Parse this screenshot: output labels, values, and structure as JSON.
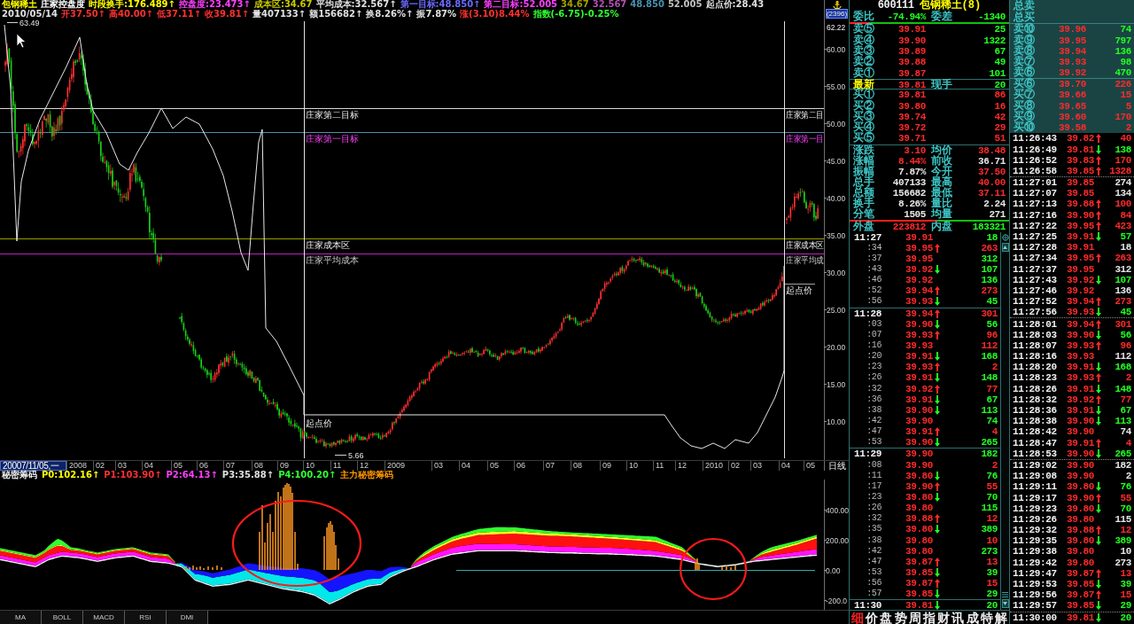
{
  "quote_header": {
    "line_1": [
      {
        "text": "包钢稀土",
        "color": "#ffff00"
      },
      {
        "text": "庄家控盘度",
        "color": "#ffffff"
      },
      {
        "text": "时段换手:176.489↑",
        "color": "#ffff00"
      },
      {
        "text": "控盘度:23.473↑",
        "color": "#ff40ff"
      },
      {
        "text": "成本区:34.67",
        "color": "#c8c800"
      },
      {
        "text": "平均成本:32.567↑",
        "color": "#e0e0e0"
      },
      {
        "text": "第一目标:48.850↑",
        "color": "#6a6aff"
      },
      {
        "text": "第二目标:52.005",
        "color": "#ff40ff"
      },
      {
        "text": "34.67",
        "color": "#a0a000"
      },
      {
        "text": "32.567",
        "color": "#b050b0"
      },
      {
        "text": "48.850",
        "color": "#4a90b0"
      },
      {
        "text": "52.005",
        "color": "#c0c0c0"
      },
      {
        "text": "起点价:28.43",
        "color": "#e0e0e0"
      }
    ],
    "line_2": [
      {
        "text": "2010/05/14",
        "color": "#e0e0e0"
      },
      {
        "text": "开37.50↑",
        "color": "#ff3030"
      },
      {
        "text": "高40.00↑",
        "color": "#ff3030"
      },
      {
        "text": "低37.11↑",
        "color": "#ff3030"
      },
      {
        "text": "收39.81↑",
        "color": "#ff3030"
      },
      {
        "text": "量407133↑",
        "color": "#e0e0e0"
      },
      {
        "text": "额156682↑",
        "color": "#e0e0e0"
      },
      {
        "text": "换8.26%↑",
        "color": "#e0e0e0"
      },
      {
        "text": "振7.87%",
        "color": "#e0e0e0"
      },
      {
        "text": "涨(3.10)8.44%",
        "color": "#ff3030"
      },
      {
        "text": "指数(-6.75)-0.25%",
        "color": "#30ff30"
      }
    ],
    "code_badge": "(2396)"
  },
  "price_chart": {
    "high_label": "63.49",
    "axis_top_label": "62.22",
    "low_label": "5.66",
    "y_ticks": [
      "60.00",
      "55.00",
      "50.00",
      "45.00",
      "40.00",
      "35.00",
      "30.00",
      "25.00",
      "20.00",
      "15.00",
      "10.00"
    ],
    "levels": [
      {
        "kind": "second_target",
        "label": "庄家第二目标",
        "edge_label": "庄家第二目"
      },
      {
        "kind": "first_target",
        "label": "庄家第一目标",
        "edge_label": "庄家第一目"
      },
      {
        "kind": "cost_zone",
        "label": "庄家成本区",
        "edge_label": "庄家成本区"
      },
      {
        "kind": "average_cost",
        "label": "庄家平均成本",
        "edge_label": "庄家平均成"
      },
      {
        "kind": "start_price",
        "label": "起点价",
        "edge_label": "起点价"
      }
    ]
  },
  "x_axis": {
    "cursor_date": "20007/11/05,一",
    "labels": [
      "2008",
      "02",
      "03",
      "04",
      "05",
      "06",
      "07",
      "08",
      "09",
      "10",
      "11",
      "12",
      "2009",
      "03",
      "04",
      "05",
      "06",
      "07",
      "08",
      "09",
      "10",
      "11",
      "12",
      "2010",
      "02",
      "03",
      "04",
      "05"
    ],
    "period": "日线"
  },
  "indicator": {
    "title": "秘密筹码",
    "values": [
      {
        "text": "P0:102.16↑",
        "color": "#ffff00"
      },
      {
        "text": "P1:103.90↑",
        "color": "#ff3030"
      },
      {
        "text": "P2:64.13↑",
        "color": "#ff40ff"
      },
      {
        "text": "P3:35.88↑",
        "color": "#e0e0e0"
      },
      {
        "text": "P4:100.20↑",
        "color": "#30ff30"
      },
      {
        "text": "主力秘密筹码",
        "color": "#ff9900"
      }
    ],
    "y_ticks": [
      "400.00",
      "200.00",
      "0.00",
      "-200.0"
    ],
    "tabs": [
      "MA",
      "BOLL",
      "MACD",
      "RSI",
      "DMI"
    ]
  },
  "quote_panel": {
    "code": "600111",
    "name": "包钢稀土(8)",
    "ratio": {
      "label": "委比",
      "value": "-74.94%",
      "diff_label": "委差",
      "diff": "-1340",
      "level": 0.13
    },
    "asks": [
      {
        "label": "卖⑤",
        "price": "39.91",
        "volume": "25"
      },
      {
        "label": "卖④",
        "price": "39.90",
        "volume": "1322"
      },
      {
        "label": "卖③",
        "price": "39.89",
        "volume": "67"
      },
      {
        "label": "卖②",
        "price": "39.88",
        "volume": "49"
      },
      {
        "label": "卖①",
        "price": "39.87",
        "volume": "101"
      }
    ],
    "last": {
      "label": "最新",
      "price": "39.81",
      "hand_label": "现手",
      "hand": "20"
    },
    "bids": [
      {
        "label": "买①",
        "price": "39.81",
        "volume": "86"
      },
      {
        "label": "买②",
        "price": "39.80",
        "volume": "16"
      },
      {
        "label": "买③",
        "price": "39.74",
        "volume": "42"
      },
      {
        "label": "买④",
        "price": "39.72",
        "volume": "29"
      },
      {
        "label": "买⑤",
        "price": "39.71",
        "volume": "51"
      }
    ],
    "stats": [
      {
        "cells": [
          {
            "label": "涨跌",
            "value": "3.10",
            "kind": "up"
          },
          {
            "label": "均价",
            "value": "38.48",
            "kind": "up"
          }
        ]
      },
      {
        "cells": [
          {
            "label": "涨幅",
            "value": "8.44%",
            "kind": "up"
          },
          {
            "label": "前收",
            "value": "36.71",
            "kind": "flat"
          }
        ]
      },
      {
        "cells": [
          {
            "label": "振幅",
            "value": "7.87%",
            "kind": "flat"
          },
          {
            "label": "今开",
            "value": "37.50",
            "kind": "up"
          }
        ]
      },
      {
        "cells": [
          {
            "label": "总手",
            "value": "407133",
            "kind": "flat"
          },
          {
            "label": "最高",
            "value": "40.00",
            "kind": "up"
          }
        ]
      },
      {
        "cells": [
          {
            "label": "总额",
            "value": "156682",
            "kind": "flat"
          },
          {
            "label": "最低",
            "value": "37.11",
            "kind": "up"
          }
        ]
      },
      {
        "cells": [
          {
            "label": "换手",
            "value": "8.26%",
            "kind": "flat"
          },
          {
            "label": "量比",
            "value": "2.24",
            "kind": "flat"
          }
        ]
      },
      {
        "cells": [
          {
            "label": "分笔",
            "value": "1505",
            "kind": "flat"
          },
          {
            "label": "均量",
            "value": "271",
            "kind": "flat"
          }
        ]
      },
      {
        "cells": [
          {
            "label": "外盘",
            "value": "223812",
            "kind": "up"
          },
          {
            "label": "内盘",
            "value": "183321",
            "kind": "down"
          }
        ]
      }
    ],
    "volume_split": {
      "level": 0.55
    },
    "ticks_by_minute": [
      {
        "rows": [
          {
            "time": "11:27",
            "price": "39.91",
            "kind": "flat",
            "buy": false,
            "volume": "18"
          },
          {
            "time": ":34",
            "price": "39.95",
            "kind": "up",
            "buy": true,
            "volume": "263"
          },
          {
            "time": ":37",
            "price": "39.95",
            "kind": "flat",
            "buy": false,
            "volume": "312"
          },
          {
            "time": ":43",
            "price": "39.92",
            "kind": "down",
            "buy": false,
            "volume": "107"
          },
          {
            "time": ":46",
            "price": "39.92",
            "kind": "flat",
            "buy": false,
            "volume": "136"
          },
          {
            "time": ":52",
            "price": "39.94",
            "kind": "up",
            "buy": true,
            "volume": "273"
          },
          {
            "time": ":56",
            "price": "39.93",
            "kind": "down",
            "buy": false,
            "volume": "45"
          }
        ]
      },
      {
        "rows": [
          {
            "time": "11:28",
            "price": "39.94",
            "kind": "up",
            "buy": true,
            "volume": "301"
          },
          {
            "time": ":03",
            "price": "39.90",
            "kind": "down",
            "buy": false,
            "volume": "56"
          },
          {
            "time": ":07",
            "price": "39.93",
            "kind": "up",
            "buy": true,
            "volume": "96"
          },
          {
            "time": ":16",
            "price": "39.93",
            "kind": "flat",
            "buy": true,
            "volume": "112"
          },
          {
            "time": ":20",
            "price": "39.91",
            "kind": "down",
            "buy": false,
            "volume": "168"
          },
          {
            "time": ":23",
            "price": "39.93",
            "kind": "up",
            "buy": true,
            "volume": "2"
          },
          {
            "time": ":26",
            "price": "39.91",
            "kind": "down",
            "buy": false,
            "volume": "148"
          },
          {
            "time": ":32",
            "price": "39.92",
            "kind": "up",
            "buy": true,
            "volume": "77"
          },
          {
            "time": ":36",
            "price": "39.91",
            "kind": "down",
            "buy": false,
            "volume": "67"
          },
          {
            "time": ":38",
            "price": "39.90",
            "kind": "down",
            "buy": false,
            "volume": "113"
          },
          {
            "time": ":42",
            "price": "39.90",
            "kind": "flat",
            "buy": false,
            "volume": "74"
          },
          {
            "time": ":47",
            "price": "39.91",
            "kind": "up",
            "buy": true,
            "volume": "4"
          },
          {
            "time": ":53",
            "price": "39.90",
            "kind": "down",
            "buy": false,
            "volume": "265"
          }
        ]
      },
      {
        "rows": [
          {
            "time": "11:29",
            "price": "39.90",
            "kind": "flat",
            "buy": false,
            "volume": "182"
          },
          {
            "time": ":08",
            "price": "39.90",
            "kind": "flat",
            "buy": true,
            "volume": "2"
          },
          {
            "time": ":11",
            "price": "39.80",
            "kind": "down",
            "buy": false,
            "volume": "76"
          },
          {
            "time": ":17",
            "price": "39.90",
            "kind": "up",
            "buy": true,
            "volume": "55"
          },
          {
            "time": ":23",
            "price": "39.80",
            "kind": "down",
            "buy": false,
            "volume": "70"
          },
          {
            "time": ":26",
            "price": "39.80",
            "kind": "flat",
            "buy": false,
            "volume": "115"
          },
          {
            "time": ":32",
            "price": "39.88",
            "kind": "up",
            "buy": true,
            "volume": "12"
          },
          {
            "time": ":35",
            "price": "39.80",
            "kind": "down",
            "buy": false,
            "volume": "389"
          },
          {
            "time": ":38",
            "price": "39.80",
            "kind": "flat",
            "buy": true,
            "volume": "10"
          },
          {
            "time": ":42",
            "price": "39.80",
            "kind": "flat",
            "buy": false,
            "volume": "273"
          },
          {
            "time": ":47",
            "price": "39.87",
            "kind": "up",
            "buy": true,
            "volume": "13"
          },
          {
            "time": ":53",
            "price": "39.85",
            "kind": "down",
            "buy": false,
            "volume": "39"
          },
          {
            "time": ":56",
            "price": "39.87",
            "kind": "up",
            "buy": true,
            "volume": "15"
          },
          {
            "time": ":57",
            "price": "39.85",
            "kind": "down",
            "buy": false,
            "volume": "29"
          }
        ]
      },
      {
        "rows": [
          {
            "time": "11:30",
            "price": "39.81",
            "kind": "down",
            "buy": false,
            "volume": "20"
          }
        ]
      }
    ],
    "detail_tabs": [
      {
        "label": "细",
        "selected": true
      },
      {
        "label": "价",
        "selected": false
      },
      {
        "label": "盘",
        "selected": false
      },
      {
        "label": "势",
        "selected": false
      },
      {
        "label": "周",
        "selected": false
      },
      {
        "label": "指",
        "selected": false
      },
      {
        "label": "财",
        "selected": false
      },
      {
        "label": "讯",
        "selected": false
      },
      {
        "label": "成",
        "selected": false
      },
      {
        "label": "特",
        "selected": false
      },
      {
        "label": "解",
        "selected": false
      }
    ],
    "depth": {
      "total_ask_label": "总卖",
      "total_bid_label": "总买",
      "asks": [
        {
          "label": "卖⑩",
          "price": "39.96",
          "volume": "74"
        },
        {
          "label": "卖⑨",
          "price": "39.95",
          "volume": "797"
        },
        {
          "label": "卖⑧",
          "price": "39.94",
          "volume": "136"
        },
        {
          "label": "卖⑦",
          "price": "39.93",
          "volume": "98"
        },
        {
          "label": "卖⑥",
          "price": "39.92",
          "volume": "470"
        }
      ],
      "bids": [
        {
          "label": "买⑥",
          "price": "39.70",
          "volume": "226"
        },
        {
          "label": "买⑦",
          "price": "39.66",
          "volume": "15"
        },
        {
          "label": "买⑧",
          "price": "39.65",
          "volume": "5"
        },
        {
          "label": "买⑨",
          "price": "39.60",
          "volume": "170"
        },
        {
          "label": "买⑩",
          "price": "39.58",
          "volume": "2"
        }
      ]
    },
    "ticks_full": [
      {
        "rows": [
          {
            "time": "11:26:43",
            "price": "39.82",
            "kind": "up",
            "volume": "40"
          },
          {
            "time": "11:26:49",
            "price": "39.81",
            "kind": "down",
            "volume": "138"
          },
          {
            "time": "11:26:52",
            "price": "39.83",
            "kind": "up",
            "volume": "170"
          },
          {
            "time": "11:26:58",
            "price": "39.85",
            "kind": "up",
            "volume": "1328"
          }
        ]
      },
      {
        "rows": [
          {
            "time": "11:27:01",
            "price": "39.85",
            "kind": "flat",
            "volume": "274"
          },
          {
            "time": "11:27:07",
            "price": "39.85",
            "kind": "flat",
            "volume": "134"
          },
          {
            "time": "11:27:13",
            "price": "39.88",
            "kind": "up",
            "volume": "100"
          },
          {
            "time": "11:27:16",
            "price": "39.90",
            "kind": "up",
            "volume": "84"
          },
          {
            "time": "11:27:22",
            "price": "39.95",
            "kind": "up",
            "volume": "423"
          },
          {
            "time": "11:27:25",
            "price": "39.91",
            "kind": "down",
            "volume": "57"
          },
          {
            "time": "11:27:28",
            "price": "39.91",
            "kind": "flat",
            "volume": "18"
          },
          {
            "time": "11:27:34",
            "price": "39.95",
            "kind": "up",
            "volume": "263"
          },
          {
            "time": "11:27:37",
            "price": "39.95",
            "kind": "flat",
            "volume": "312"
          },
          {
            "time": "11:27:43",
            "price": "39.92",
            "kind": "down",
            "volume": "107"
          },
          {
            "time": "11:27:46",
            "price": "39.92",
            "kind": "flat",
            "volume": "136"
          },
          {
            "time": "11:27:52",
            "price": "39.94",
            "kind": "up",
            "volume": "273"
          },
          {
            "time": "11:27:56",
            "price": "39.93",
            "kind": "down",
            "volume": "45"
          }
        ]
      },
      {
        "rows": [
          {
            "time": "11:28:01",
            "price": "39.94",
            "kind": "up",
            "volume": "301"
          },
          {
            "time": "11:28:03",
            "price": "39.90",
            "kind": "down",
            "volume": "56"
          },
          {
            "time": "11:28:07",
            "price": "39.93",
            "kind": "up",
            "volume": "96"
          },
          {
            "time": "11:28:16",
            "price": "39.93",
            "kind": "flat",
            "volume": "112"
          },
          {
            "time": "11:28:20",
            "price": "39.91",
            "kind": "down",
            "volume": "168"
          },
          {
            "time": "11:28:23",
            "price": "39.93",
            "kind": "up",
            "volume": "2"
          },
          {
            "time": "11:28:26",
            "price": "39.91",
            "kind": "down",
            "volume": "148"
          },
          {
            "time": "11:28:32",
            "price": "39.92",
            "kind": "up",
            "volume": "77"
          },
          {
            "time": "11:28:36",
            "price": "39.91",
            "kind": "down",
            "volume": "67"
          },
          {
            "time": "11:28:38",
            "price": "39.90",
            "kind": "down",
            "volume": "113"
          },
          {
            "time": "11:28:42",
            "price": "39.90",
            "kind": "flat",
            "volume": "74"
          },
          {
            "time": "11:28:47",
            "price": "39.91",
            "kind": "up",
            "volume": "4"
          },
          {
            "time": "11:28:53",
            "price": "39.90",
            "kind": "down",
            "volume": "265"
          }
        ]
      },
      {
        "rows": [
          {
            "time": "11:29:02",
            "price": "39.90",
            "kind": "flat",
            "volume": "182"
          },
          {
            "time": "11:29:08",
            "price": "39.90",
            "kind": "flat",
            "volume": "2"
          },
          {
            "time": "11:29:11",
            "price": "39.80",
            "kind": "down",
            "volume": "76"
          },
          {
            "time": "11:29:17",
            "price": "39.90",
            "kind": "up",
            "volume": "55"
          },
          {
            "time": "11:29:23",
            "price": "39.80",
            "kind": "down",
            "volume": "70"
          },
          {
            "time": "11:29:26",
            "price": "39.80",
            "kind": "flat",
            "volume": "115"
          },
          {
            "time": "11:29:32",
            "price": "39.88",
            "kind": "up",
            "volume": "12"
          },
          {
            "time": "11:29:35",
            "price": "39.80",
            "kind": "down",
            "volume": "389"
          },
          {
            "time": "11:29:38",
            "price": "39.80",
            "kind": "flat",
            "volume": "10"
          },
          {
            "time": "11:29:42",
            "price": "39.80",
            "kind": "flat",
            "volume": "273"
          },
          {
            "time": "11:29:47",
            "price": "39.87",
            "kind": "up",
            "volume": "13"
          },
          {
            "time": "11:29:53",
            "price": "39.85",
            "kind": "down",
            "volume": "39"
          },
          {
            "time": "11:29:56",
            "price": "39.87",
            "kind": "up",
            "volume": "15"
          },
          {
            "time": "11:29:57",
            "price": "39.85",
            "kind": "down",
            "volume": "29"
          }
        ]
      },
      {
        "rows": [
          {
            "time": "11:30:00",
            "price": "39.81",
            "kind": "down",
            "volume": "20"
          }
        ]
      }
    ]
  }
}
